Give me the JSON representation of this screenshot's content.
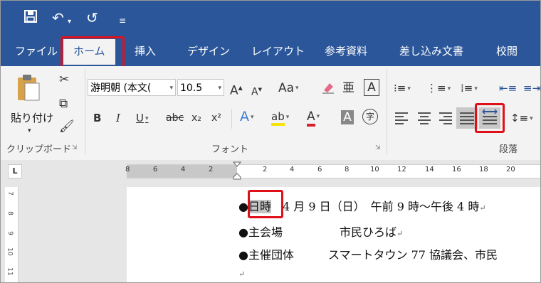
{
  "qat": {
    "save_icon": "save-icon",
    "undo_icon": "undo-icon",
    "redo_icon": "repeat-icon",
    "customize_icon": "customize-qat-icon"
  },
  "tabs": [
    {
      "label": "ファイル"
    },
    {
      "label": "ホーム"
    },
    {
      "label": "挿入"
    },
    {
      "label": "デザイン"
    },
    {
      "label": "レイアウト"
    },
    {
      "label": "参考資料"
    },
    {
      "label": "差し込み文書"
    },
    {
      "label": "校閲"
    }
  ],
  "ribbon": {
    "clipboard": {
      "paste_label": "貼り付け",
      "group_label": "クリップボード"
    },
    "font": {
      "font_name": "游明朝 (本文(",
      "font_size": "10.5",
      "group_label": "フォント",
      "grow_label": "A",
      "shrink_label": "A",
      "case_label": "Aa",
      "bold": "B",
      "italic": "I",
      "underline": "U",
      "strike": "abc",
      "subscript": "x₂",
      "superscript": "x²",
      "text_effect": "A",
      "highlight": "ab",
      "font_color": "A",
      "shading": "A",
      "enclose": "字",
      "phonetic": "亜",
      "border": "A"
    },
    "paragraph": {
      "group_label": "段落"
    }
  },
  "ruler": {
    "left_numbers": [
      "8",
      "6",
      "4",
      "2"
    ],
    "right_numbers": [
      "2",
      "4",
      "6",
      "8",
      "10",
      "12",
      "14",
      "16",
      "18",
      "20"
    ],
    "tab_selector": "L",
    "vertical_numbers": [
      "7",
      "8",
      "9",
      "10",
      "11"
    ]
  },
  "document": {
    "line1_bullet": "●",
    "line1_label": "日時",
    "line1_value": "4 月 9 日（日）　午前 9 時～午後 4 時",
    "line2": "●主会場　　　　　市民ひろば",
    "line3": "●主催団体　　　スマートタウン 77 協議会、市民",
    "para_mark": "↵"
  },
  "colors": {
    "title_bar": "#2b579a",
    "highlight_box": "#e0101a",
    "ribbon": "#f3f3f3"
  }
}
